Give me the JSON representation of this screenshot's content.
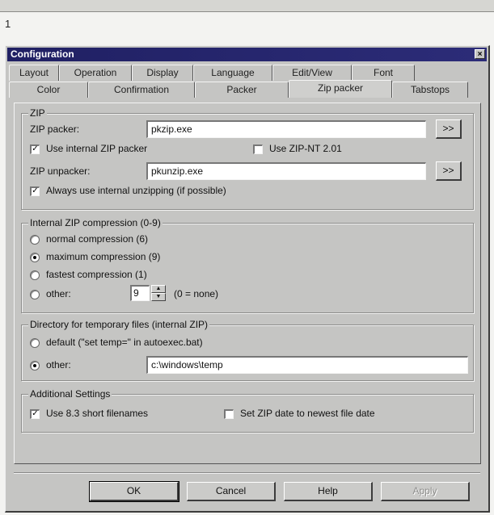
{
  "figure_number": "1",
  "window": {
    "title": "Configuration",
    "close_label": "×"
  },
  "tabs_row1": [
    "Layout",
    "Operation",
    "Display",
    "Language",
    "Edit/View",
    "Font"
  ],
  "tabs_row2": [
    "Color",
    "Confirmation",
    "Packer",
    "Zip packer",
    "Tabstops"
  ],
  "active_tab": "Zip packer",
  "zip": {
    "group_title": "ZIP",
    "packer_label": "ZIP packer:",
    "packer_value": "pkzip.exe",
    "browse_label": ">>",
    "use_internal_label": "Use internal ZIP packer",
    "use_internal_checked": true,
    "use_zipnt_label": "Use ZIP-NT 2.01",
    "use_zipnt_checked": false,
    "unpacker_label": "ZIP unpacker:",
    "unpacker_value": "pkunzip.exe",
    "always_internal_label": "Always use internal unzipping (if possible)",
    "always_internal_checked": true
  },
  "compression": {
    "group_title": "Internal ZIP compression (0-9)",
    "options": [
      {
        "label": "normal compression (6)",
        "selected": false
      },
      {
        "label": "maximum compression (9)",
        "selected": true
      },
      {
        "label": "fastest compression (1)",
        "selected": false
      }
    ],
    "other_label": "other:",
    "other_selected": false,
    "other_value": "9",
    "other_hint": "(0 = none)"
  },
  "tempdir": {
    "group_title": "Directory for temporary files (internal ZIP)",
    "default_label": "default (\"set temp=\" in autoexec.bat)",
    "default_selected": false,
    "other_label": "other:",
    "other_selected": true,
    "other_value": "c:\\windows\\temp"
  },
  "additional": {
    "group_title": "Additional Settings",
    "short_names_label": "Use 8.3 short filenames",
    "short_names_checked": true,
    "zip_date_label": "Set ZIP date to newest file date",
    "zip_date_checked": false
  },
  "buttons": {
    "ok": "OK",
    "cancel": "Cancel",
    "help": "Help",
    "apply": "Apply"
  },
  "colors": {
    "title_bar": "#202063",
    "face": "#c5c5c3"
  }
}
